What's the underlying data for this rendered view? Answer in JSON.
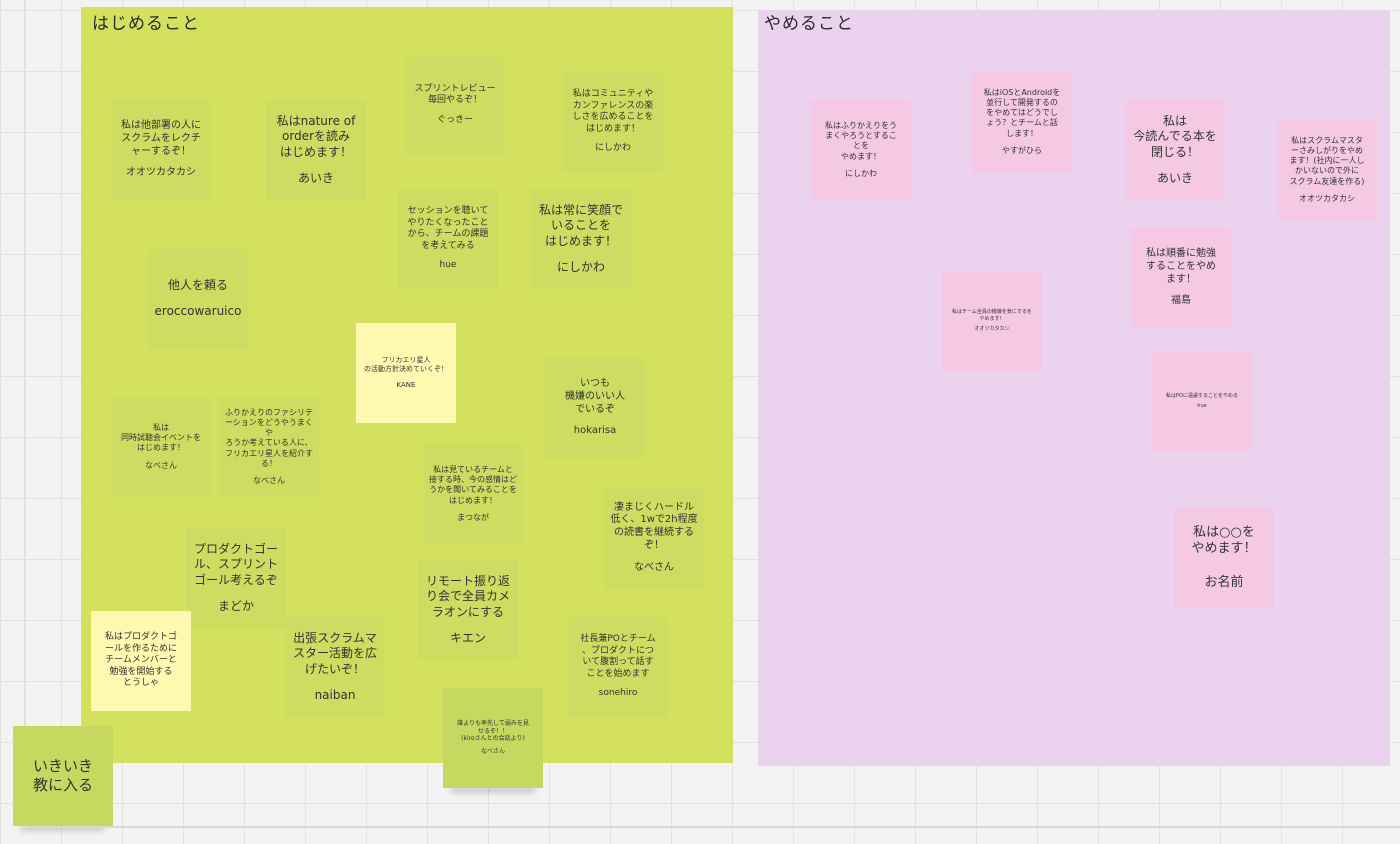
{
  "frames": {
    "start": {
      "title": "はじめること"
    },
    "stop": {
      "title": "やめること"
    }
  },
  "notes": {
    "n01": {
      "text": "私は他部署の人に\nスクラムをレクチ\nャーするぞ！",
      "author": "オオツカタカシ"
    },
    "n02": {
      "text": "私はnature of\norderを読み\nはじめます！",
      "author": "あいき"
    },
    "n03": {
      "text": "スプリントレビュー\n毎回やるぞ！",
      "author": "ぐっきー"
    },
    "n04": {
      "text": "私はコミュニティや\nカンファレンスの楽\nしさを広めることを\nはじめます！",
      "author": "にしかわ"
    },
    "n05": {
      "text": "セッションを聴いて\nやりたくなったこと\nから、チームの課題\nを考えてみる",
      "author": "hue"
    },
    "n06": {
      "text": "私は常に笑顔で\nいることを\nはじめます！",
      "author": "にしかわ"
    },
    "n07": {
      "text": "他人を頼る",
      "author": "eroccowaruico"
    },
    "n08": {
      "text": "フリカエリ星人\nの活動方針決めていくぞ！",
      "author": "KANE"
    },
    "n09": {
      "text": "いつも\n機嫌のいい人\nでいるぞ",
      "author": "hokarisa"
    },
    "n10": {
      "text": "私は\n同時試聴会イベントを\nはじめます！",
      "author": "なべさん"
    },
    "n11": {
      "text": "ふりかえりのファシリテ\nーションをどうやうまくや\nろうか考えている人に、\nフリカエリ星人を紹介す\nる！",
      "author": "なべさん"
    },
    "n12": {
      "text": "私は見ているチームと\n接する時、今の感情はど\nうかを聞いてみることを\nはじめます！",
      "author": "まつなが"
    },
    "n13": {
      "text": "凄まじくハードル\n低く、1wで2h程度\nの読書を継続する\nぞ！",
      "author": "なべさん"
    },
    "n14": {
      "text": "プロダクトゴー\nル、スプリント\nゴール考えるぞ",
      "author": "まどか"
    },
    "n15": {
      "text": "リモート振り返\nり会で全員カメ\nラオンにする",
      "author": "キエン"
    },
    "n16": {
      "text": "私はプロダクトゴ\nールを作るために\nチームメンバーと\n勉強を開始する",
      "author": "とうしゃ"
    },
    "n17": {
      "text": "出張スクラムマ\nスター活動を広\nげたいぞ！",
      "author": "naiban"
    },
    "n18": {
      "text": "社長兼POとチーム\n、プロダクトにつ\nいて腹割って話す\nことを始めます",
      "author": "sonehiro"
    },
    "n19": {
      "text": "誰よりも率先して弱みを見\nせるぞ！！\n(kiroさんとの会話より)",
      "author": "なべさん"
    },
    "n20": {
      "text": "いきいき\n教に入る",
      "author": ""
    },
    "p01": {
      "text": "私はふりかえりをう\nまくやろうとするこ\nとを\nやめます！",
      "author": "にしかわ"
    },
    "p02": {
      "text": "私はiOSとAndroidを\n並行して開発するの\nをやめてはどうでし\nょう？とチームと話\nします！",
      "author": "やすがひら"
    },
    "p03": {
      "text": "私は\n今読んでる本を\n閉じる！",
      "author": "あいき"
    },
    "p04": {
      "text": "私はスクラムマスタ\nーさみしがりをやめ\nます！(社内に一人し\nかいないので外に\nスクラム友達を作る)",
      "author": "オオツカタカシ"
    },
    "p05": {
      "text": "私は順番に勉強\nすることをやめ\nます！",
      "author": "福島"
    },
    "p06": {
      "text": "私はチーム全員の機嫌を気にするを\nやめます！",
      "author": "オオツカタカシ"
    },
    "p07": {
      "text": "私はPOに遠慮することをやめる",
      "author": "hue"
    },
    "p08": {
      "text": "私は○○を\nやめます！",
      "author": "お名前"
    }
  }
}
